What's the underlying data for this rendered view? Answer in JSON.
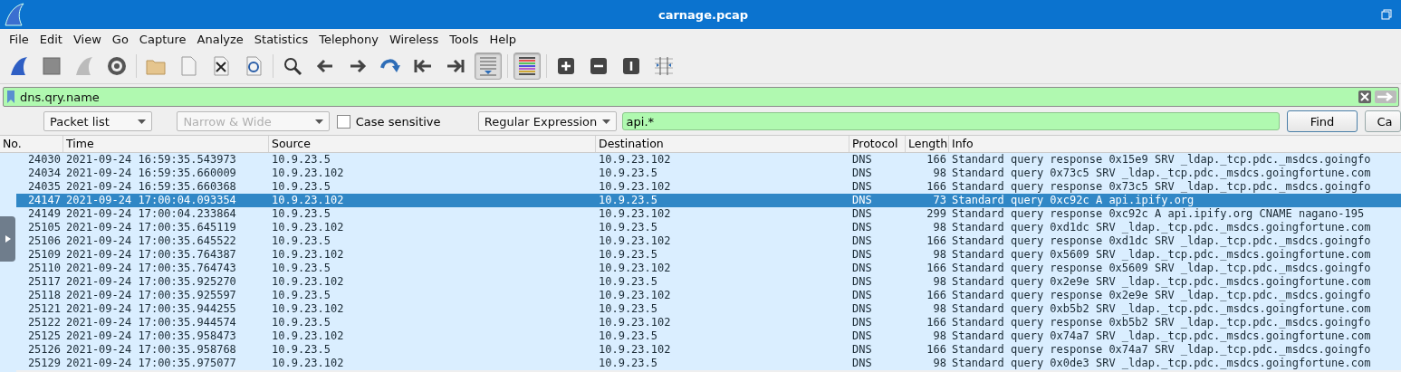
{
  "window": {
    "title": "carnage.pcap"
  },
  "menu": [
    "File",
    "Edit",
    "View",
    "Go",
    "Capture",
    "Analyze",
    "Statistics",
    "Telephony",
    "Wireless",
    "Tools",
    "Help"
  ],
  "toolbar": [
    {
      "kind": "start",
      "pressed": false
    },
    {
      "kind": "stop",
      "pressed": false
    },
    {
      "kind": "restart",
      "pressed": false
    },
    {
      "kind": "options",
      "pressed": false
    },
    {
      "kind": "sep"
    },
    {
      "kind": "open",
      "pressed": false
    },
    {
      "kind": "file",
      "pressed": false
    },
    {
      "kind": "close",
      "pressed": false
    },
    {
      "kind": "reload",
      "pressed": false
    },
    {
      "kind": "sep"
    },
    {
      "kind": "search",
      "pressed": false
    },
    {
      "kind": "back",
      "pressed": false
    },
    {
      "kind": "forward",
      "pressed": false
    },
    {
      "kind": "jump",
      "pressed": false
    },
    {
      "kind": "first",
      "pressed": false
    },
    {
      "kind": "last",
      "pressed": false
    },
    {
      "kind": "autoscroll",
      "pressed": true
    },
    {
      "kind": "sep"
    },
    {
      "kind": "colorize",
      "pressed": true
    },
    {
      "kind": "sep"
    },
    {
      "kind": "zoomin",
      "pressed": false
    },
    {
      "kind": "zoomout",
      "pressed": false
    },
    {
      "kind": "normal",
      "pressed": false
    },
    {
      "kind": "resize",
      "pressed": false
    }
  ],
  "display_filter": {
    "value": "dns.qry.name"
  },
  "find_bar": {
    "search_in": "Packet list",
    "char_width": "Narrow & Wide",
    "case_sensitive": false,
    "case_label": "Case sensitive",
    "search_type": "Regular Expression",
    "value": "api.*",
    "find_button": "Find",
    "cancel_button": "Ca"
  },
  "table": {
    "columns": [
      "No.",
      "Time",
      "Source",
      "Destination",
      "Protocol",
      "Length",
      "Info"
    ],
    "rows": [
      {
        "no": "24030",
        "time": "2021-09-24 16:59:35.543973",
        "source": "10.9.23.5",
        "destination": "10.9.23.102",
        "protocol": "DNS",
        "length": "166",
        "info": "Standard query response 0x15e9 SRV _ldap._tcp.pdc._msdcs.goingfo",
        "selected": false
      },
      {
        "no": "24034",
        "time": "2021-09-24 16:59:35.660009",
        "source": "10.9.23.102",
        "destination": "10.9.23.5",
        "protocol": "DNS",
        "length": "98",
        "info": "Standard query 0x73c5 SRV _ldap._tcp.pdc._msdcs.goingfortune.com",
        "selected": false
      },
      {
        "no": "24035",
        "time": "2021-09-24 16:59:35.660368",
        "source": "10.9.23.5",
        "destination": "10.9.23.102",
        "protocol": "DNS",
        "length": "166",
        "info": "Standard query response 0x73c5 SRV _ldap._tcp.pdc._msdcs.goingfo",
        "selected": false
      },
      {
        "no": "24147",
        "time": "2021-09-24 17:00:04.093354",
        "source": "10.9.23.102",
        "destination": "10.9.23.5",
        "protocol": "DNS",
        "length": "73",
        "info": "Standard query 0xc92c A api.ipify.org",
        "selected": true
      },
      {
        "no": "24149",
        "time": "2021-09-24 17:00:04.233864",
        "source": "10.9.23.5",
        "destination": "10.9.23.102",
        "protocol": "DNS",
        "length": "299",
        "info": "Standard query response 0xc92c A api.ipify.org CNAME nagano-195",
        "selected": false
      },
      {
        "no": "25105",
        "time": "2021-09-24 17:00:35.645119",
        "source": "10.9.23.102",
        "destination": "10.9.23.5",
        "protocol": "DNS",
        "length": "98",
        "info": "Standard query 0xd1dc SRV _ldap._tcp.pdc._msdcs.goingfortune.com",
        "selected": false
      },
      {
        "no": "25106",
        "time": "2021-09-24 17:00:35.645522",
        "source": "10.9.23.5",
        "destination": "10.9.23.102",
        "protocol": "DNS",
        "length": "166",
        "info": "Standard query response 0xd1dc SRV _ldap._tcp.pdc._msdcs.goingfo",
        "selected": false
      },
      {
        "no": "25109",
        "time": "2021-09-24 17:00:35.764387",
        "source": "10.9.23.102",
        "destination": "10.9.23.5",
        "protocol": "DNS",
        "length": "98",
        "info": "Standard query 0x5609 SRV _ldap._tcp.pdc._msdcs.goingfortune.com",
        "selected": false
      },
      {
        "no": "25110",
        "time": "2021-09-24 17:00:35.764743",
        "source": "10.9.23.5",
        "destination": "10.9.23.102",
        "protocol": "DNS",
        "length": "166",
        "info": "Standard query response 0x5609 SRV _ldap._tcp.pdc._msdcs.goingfo",
        "selected": false
      },
      {
        "no": "25117",
        "time": "2021-09-24 17:00:35.925270",
        "source": "10.9.23.102",
        "destination": "10.9.23.5",
        "protocol": "DNS",
        "length": "98",
        "info": "Standard query 0x2e9e SRV _ldap._tcp.pdc._msdcs.goingfortune.com",
        "selected": false
      },
      {
        "no": "25118",
        "time": "2021-09-24 17:00:35.925597",
        "source": "10.9.23.5",
        "destination": "10.9.23.102",
        "protocol": "DNS",
        "length": "166",
        "info": "Standard query response 0x2e9e SRV _ldap._tcp.pdc._msdcs.goingfo",
        "selected": false
      },
      {
        "no": "25121",
        "time": "2021-09-24 17:00:35.944255",
        "source": "10.9.23.102",
        "destination": "10.9.23.5",
        "protocol": "DNS",
        "length": "98",
        "info": "Standard query 0xb5b2 SRV _ldap._tcp.pdc._msdcs.goingfortune.com",
        "selected": false
      },
      {
        "no": "25122",
        "time": "2021-09-24 17:00:35.944574",
        "source": "10.9.23.5",
        "destination": "10.9.23.102",
        "protocol": "DNS",
        "length": "166",
        "info": "Standard query response 0xb5b2 SRV _ldap._tcp.pdc._msdcs.goingfo",
        "selected": false
      },
      {
        "no": "25125",
        "time": "2021-09-24 17:00:35.958473",
        "source": "10.9.23.102",
        "destination": "10.9.23.5",
        "protocol": "DNS",
        "length": "98",
        "info": "Standard query 0x74a7 SRV _ldap._tcp.pdc._msdcs.goingfortune.com",
        "selected": false
      },
      {
        "no": "25126",
        "time": "2021-09-24 17:00:35.958768",
        "source": "10.9.23.5",
        "destination": "10.9.23.102",
        "protocol": "DNS",
        "length": "166",
        "info": "Standard query response 0x74a7 SRV _ldap._tcp.pdc._msdcs.goingfo",
        "selected": false
      },
      {
        "no": "25129",
        "time": "2021-09-24 17:00:35.975077",
        "source": "10.9.23.102",
        "destination": "10.9.23.5",
        "protocol": "DNS",
        "length": "98",
        "info": "Standard query 0x0de3 SRV _ldap._tcp.pdc._msdcs.goingfortune.com",
        "selected": false
      }
    ]
  }
}
